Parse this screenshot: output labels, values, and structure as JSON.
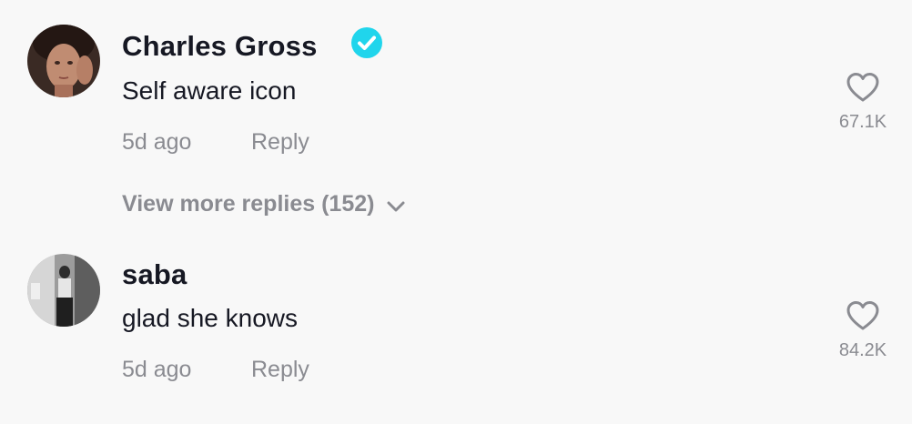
{
  "comments": [
    {
      "username": "Charles Gross",
      "verified": true,
      "text": "Self aware icon",
      "time": "5d ago",
      "reply_label": "Reply",
      "likes": "67.1K"
    },
    {
      "username": "saba",
      "verified": false,
      "text": "glad she knows",
      "time": "5d ago",
      "reply_label": "Reply",
      "likes": "84.2K"
    }
  ],
  "view_more_replies": "View more replies (152)",
  "colors": {
    "verified": "#20d5ec",
    "muted_text": "#8a8b91",
    "primary_text": "#161823",
    "background": "#f8f8f8"
  },
  "icons": {
    "verified": "verified-badge-icon",
    "like": "heart-outline-icon",
    "expand": "chevron-down-icon"
  }
}
